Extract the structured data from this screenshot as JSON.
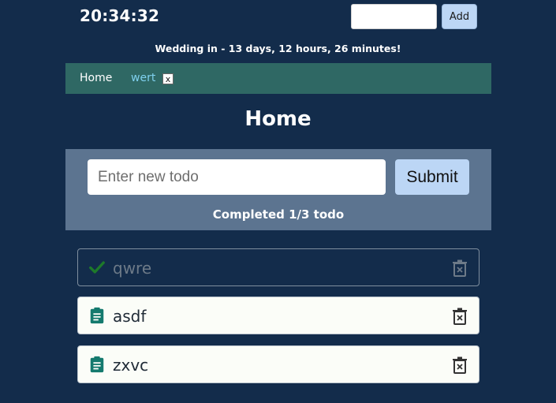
{
  "header": {
    "clock": "20:34:32",
    "tab_input_value": "",
    "add_label": "Add"
  },
  "countdown": "Wedding in - 13 days, 12 hours, 26 minutes!",
  "nav": {
    "tabs": [
      {
        "label": "Home"
      },
      {
        "label": "wert",
        "close_label": "x"
      }
    ]
  },
  "page": {
    "title": "Home"
  },
  "form": {
    "placeholder": "Enter new todo",
    "value": "",
    "submit_label": "Submit",
    "completed_text": "Completed 1/3 todo"
  },
  "todos": [
    {
      "text": "qwre",
      "completed": true,
      "icon": "check-icon"
    },
    {
      "text": "asdf",
      "completed": false,
      "icon": "clipboard-icon"
    },
    {
      "text": "zxvc",
      "completed": false,
      "icon": "clipboard-icon"
    }
  ],
  "colors": {
    "background": "#132c4b",
    "navbar": "#2f6864",
    "form_panel": "#5c7490",
    "button": "#bcd6f5",
    "check": "#1e7a2a",
    "clipboard": "#147a6e",
    "active_tab": "#7fd0ee"
  }
}
